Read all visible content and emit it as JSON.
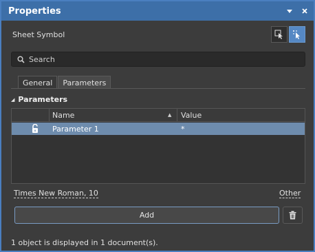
{
  "window": {
    "title": "Properties"
  },
  "titlebar": {
    "pin_icon": "dropdown-pin-icon",
    "close_icon": "close-icon"
  },
  "object": {
    "type_label": "Sheet Symbol"
  },
  "search": {
    "placeholder": "Search"
  },
  "tabs": [
    {
      "label": "General",
      "active": false
    },
    {
      "label": "Parameters",
      "active": true
    }
  ],
  "section": {
    "title": "Parameters"
  },
  "grid": {
    "columns": {
      "name": "Name",
      "value": "Value"
    },
    "rows": [
      {
        "name": "Parameter 1",
        "value": "*",
        "locked": false,
        "selected": true
      }
    ]
  },
  "footer": {
    "font_label": "Times New Roman, 10",
    "other_label": "Other",
    "add_label": "Add"
  },
  "status": {
    "text": "1 object is displayed in 1 document(s)."
  },
  "colors": {
    "accent": "#3d6fa8",
    "selected_row": "#6e8cad",
    "panel_bg": "#3c3c3c"
  }
}
